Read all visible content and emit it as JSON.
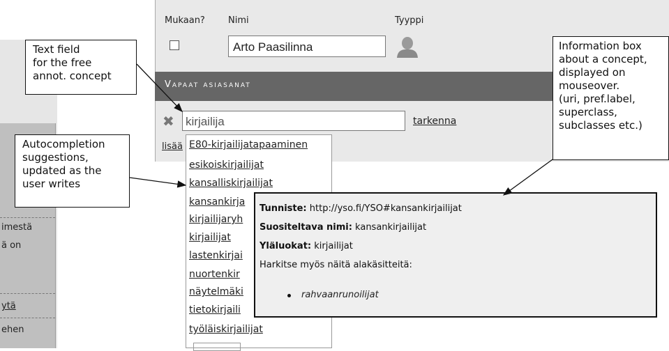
{
  "left": {
    "text_1": "imestä",
    "text_2": "ä on",
    "link_1": "ytä",
    "text_3": "ehen"
  },
  "form": {
    "headers": {
      "include": "Mukaan?",
      "name": "Nimi",
      "type": "Tyyppi"
    },
    "name_value": "Arto Paasilinna",
    "section_title": "Vapaat asiasanat",
    "search_value": "kirjailija",
    "refine_link": "tarkenna",
    "add_link": "lisää"
  },
  "dropdown": {
    "items": [
      "E80-kirjailijatapaaminen",
      "esikoiskirjailijat",
      "kansalliskirjailijat",
      "kansankirja",
      "kirjailijaryh",
      "kirjailijat",
      "lastenkirjai",
      "nuortenkir",
      "näytelmäki",
      "tietokirjaili",
      "työläiskirjailijat"
    ]
  },
  "infobox": {
    "id_label": "Tunniste:",
    "id_value": "http://yso.fi/YSO#kansankirjailijat",
    "pref_label": "Suositeltava nimi:",
    "pref_value": "kansankirjailijat",
    "super_label": "Yläluokat:",
    "super_value": "kirjailijat",
    "consider_text": "Harkitse myös näitä alakäsitteitä:",
    "subclass": "rahvaanrunoilijat"
  },
  "annotations": {
    "text_field": [
      "Text field",
      "for the free",
      "annot. concept"
    ],
    "autocompletion": [
      "Autocompletion",
      "suggestions,",
      "updated as the",
      "user writes"
    ],
    "info_box": [
      "Information box",
      "about a concept,",
      "displayed on",
      "mouseover.",
      "(uri, pref.label,",
      "superclass,",
      "subclasses etc.)"
    ]
  },
  "icons": {
    "remove": "close-x-icon",
    "person": "person-icon"
  }
}
